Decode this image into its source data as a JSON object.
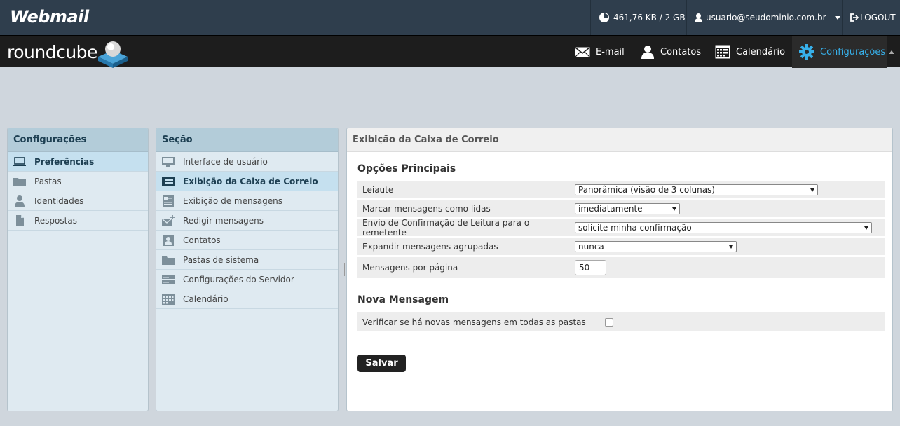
{
  "topbar": {
    "brand": "Webmail",
    "quota": "461,76 KB / 2 GB",
    "user": "usuario@seudominio.com.br",
    "logout": "LOGOUT"
  },
  "nav": {
    "logo": "roundcube",
    "items": [
      {
        "label": "E-mail",
        "icon": "envelope-icon"
      },
      {
        "label": "Contatos",
        "icon": "person-icon"
      },
      {
        "label": "Calendário",
        "icon": "calendar-icon"
      },
      {
        "label": "Configurações",
        "icon": "gear-icon",
        "active": true
      }
    ]
  },
  "settings_panel": {
    "title": "Configurações",
    "items": [
      {
        "label": "Preferências",
        "icon": "laptop-icon",
        "selected": true
      },
      {
        "label": "Pastas",
        "icon": "folder-icon"
      },
      {
        "label": "Identidades",
        "icon": "person-icon"
      },
      {
        "label": "Respostas",
        "icon": "document-icon"
      }
    ]
  },
  "section_panel": {
    "title": "Seção",
    "items": [
      {
        "label": "Interface de usuário",
        "icon": "monitor-icon"
      },
      {
        "label": "Exibição da Caixa de Correio",
        "icon": "mailbox-layout-icon",
        "selected": true
      },
      {
        "label": "Exibição de mensagens",
        "icon": "message-view-icon"
      },
      {
        "label": "Redigir mensagens",
        "icon": "compose-icon"
      },
      {
        "label": "Contatos",
        "icon": "contact-card-icon"
      },
      {
        "label": "Pastas de sistema",
        "icon": "folder-icon"
      },
      {
        "label": "Configurações do Servidor",
        "icon": "server-icon"
      },
      {
        "label": "Calendário",
        "icon": "calendar-icon"
      }
    ]
  },
  "content": {
    "title": "Exibição da Caixa de Correio",
    "main_section": "Opções Principais",
    "fields": [
      {
        "label": "Leiaute",
        "value": "Panorâmica (visão de 3 colunas)"
      },
      {
        "label": "Marcar mensagens como lidas",
        "value": "imediatamente"
      },
      {
        "label": "Envio de Confirmação de Leitura para o remetente",
        "value": "solicite minha confirmação"
      },
      {
        "label": "Expandir mensagens agrupadas",
        "value": "nunca"
      },
      {
        "label": "Mensagens por página",
        "value": "50"
      }
    ],
    "new_section": "Nova Mensagem",
    "check_label": "Verificar se há novas mensagens em todas as pastas",
    "check_value": false,
    "save": "Salvar"
  }
}
